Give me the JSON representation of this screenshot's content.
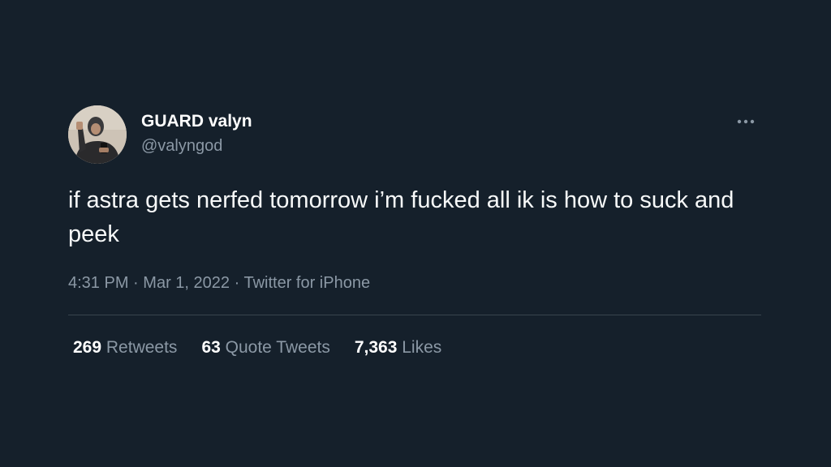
{
  "tweet": {
    "author": {
      "display_name": "GUARD valyn",
      "handle": "@valyngod",
      "avatar_icon": "profile-photo"
    },
    "text": "if astra gets nerfed tomorrow i’m fucked all ik is how to suck and peek",
    "time": "4:31 PM",
    "date": "Mar 1, 2022",
    "source": "Twitter for iPhone",
    "separator": "·",
    "more_icon": "ellipsis-icon",
    "stats": [
      {
        "count": "269",
        "label": "Retweets"
      },
      {
        "count": "63",
        "label": "Quote Tweets"
      },
      {
        "count": "7,363",
        "label": "Likes"
      }
    ]
  },
  "colors": {
    "background": "#15202b",
    "primary_text": "#f7f9f9",
    "secondary_text": "#8b98a5",
    "divider": "#38444d"
  }
}
